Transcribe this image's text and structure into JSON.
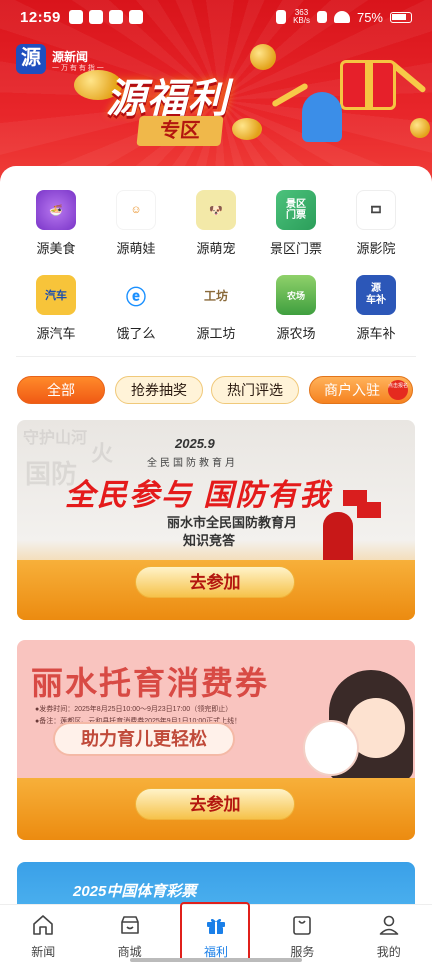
{
  "status_bar": {
    "time": "12:59",
    "network_speed": "363\nKB/s",
    "battery": "75%"
  },
  "header": {
    "logo_char": "源",
    "logo_name": "源新闻",
    "logo_tagline": "一 万 有 有 指 一",
    "title": "源福利",
    "subtitle": "专区"
  },
  "services": [
    {
      "label": "源美食",
      "icon": "noodle-bowl-icon",
      "color": "#8e4fd8"
    },
    {
      "label": "源萌娃",
      "icon": "smiley-baby-icon",
      "color": "#f6d34a"
    },
    {
      "label": "源萌宠",
      "icon": "pet-dog-cat-icon",
      "color": "#6a5a48"
    },
    {
      "label": "景区门票",
      "icon": "ticket-icon",
      "color": "#3bb36a"
    },
    {
      "label": "源影院",
      "icon": "film-icon",
      "color": "#c6c6c6"
    },
    {
      "label": "源汽车",
      "icon": "car-icon",
      "color": "#1d5fbf"
    },
    {
      "label": "饿了么",
      "icon": "eleme-icon",
      "color": "#ffffff"
    },
    {
      "label": "源工坊",
      "icon": "workshop-icon",
      "color": "#ffffff"
    },
    {
      "label": "源农场",
      "icon": "farm-icon",
      "color": "#3f9f3f"
    },
    {
      "label": "源车补",
      "icon": "car-subsidy-icon",
      "color": "#2c57b8"
    }
  ],
  "filters": {
    "all": "全部",
    "lottery": "抢券抽奖",
    "popular": "热门评选",
    "merchant": "商户入驻",
    "merchant_badge": "点击报名"
  },
  "banner1": {
    "year": "2025.9",
    "kicker": "全民国防教育月",
    "headline": "全民参与 国防有我",
    "line1": "丽水市全民国防教育月",
    "line2": "知识竞答",
    "button": "去参加"
  },
  "banner2": {
    "title": "丽水托育消费券",
    "line1": "●发券时间：2025年8月25日10:00～9月23日17:00（领完即止）",
    "line2": "●备注：莲都区、云和县托育消费券2025年9月1日10:00正式上线！",
    "pill": "助力育儿更轻松",
    "button": "去参加"
  },
  "banner3": {
    "title": "2025中国体育彩票"
  },
  "nav": {
    "tabs": [
      {
        "label": "新闻",
        "icon": "home-icon"
      },
      {
        "label": "商城",
        "icon": "store-icon"
      },
      {
        "label": "福利",
        "icon": "gift-icon",
        "active": true
      },
      {
        "label": "服务",
        "icon": "bag-icon"
      },
      {
        "label": "我的",
        "icon": "person-icon"
      }
    ]
  },
  "colors": {
    "brand_red": "#e0201b",
    "accent_orange": "#f05a14",
    "nav_active": "#1a7fe8"
  }
}
